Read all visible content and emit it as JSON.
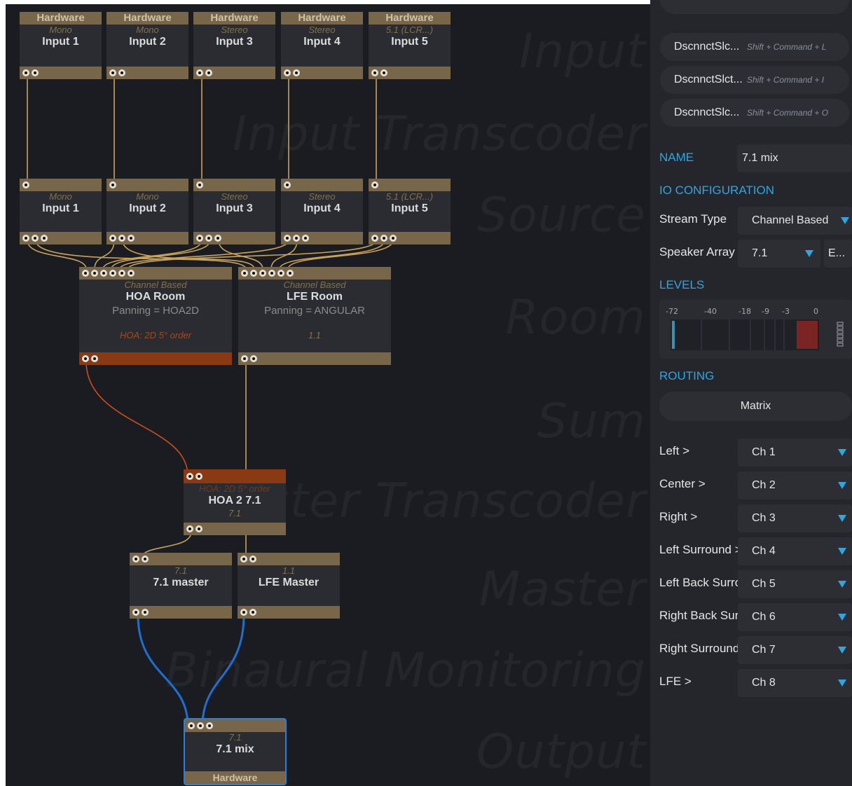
{
  "canvas": {
    "background_labels": [
      "Input",
      "Input Transcoder",
      "Source",
      "Room",
      "Sum",
      "Master Transcoder",
      "Master",
      "Binaural Monitoring",
      "Output"
    ],
    "wire_colors": {
      "default": "#c9a25c",
      "hoa": "#c8501a",
      "output": "#1f6fd0"
    }
  },
  "nodes": {
    "hw": [
      {
        "bar": "Hardware",
        "sub": "Mono",
        "title": "Input 1"
      },
      {
        "bar": "Hardware",
        "sub": "Mono",
        "title": "Input 2"
      },
      {
        "bar": "Hardware",
        "sub": "Stereo",
        "title": "Input 3"
      },
      {
        "bar": "Hardware",
        "sub": "Stereo",
        "title": "Input 4"
      },
      {
        "bar": "Hardware",
        "sub": "5.1 (LCR...)",
        "title": "Input 5"
      }
    ],
    "src": [
      {
        "sub": "Mono",
        "title": "Input 1"
      },
      {
        "sub": "Mono",
        "title": "Input 2"
      },
      {
        "sub": "Stereo",
        "title": "Input 3"
      },
      {
        "sub": "Stereo",
        "title": "Input 4"
      },
      {
        "sub": "5.1 (LCR...)",
        "title": "Input 5"
      }
    ],
    "hoa_room": {
      "sub": "Channel Based",
      "title": "HOA Room",
      "panning": "Panning = HOA2D",
      "footer": "HOA: 2D 5° order"
    },
    "lfe_room": {
      "sub": "Channel Based",
      "title": "LFE Room",
      "panning": "Panning = ANGULAR",
      "footer": "1.1"
    },
    "hoa2": {
      "header": "HOA: 2D 5° order",
      "title": "HOA 2 7.1",
      "sub": "7.1"
    },
    "master71": {
      "sub": "7.1",
      "title": "7.1 master"
    },
    "lfe_master": {
      "sub": "1.1",
      "title": "LFE Master"
    },
    "output": {
      "sub": "7.1",
      "title": "7.1 mix",
      "footer": "Hardware"
    }
  },
  "panel": {
    "disconnect_buttons": [
      {
        "label": "DscnnctSlc...",
        "shortcut": "Shift + Command + L"
      },
      {
        "label": "DscnnctSlct...",
        "shortcut": "Shift + Command + I"
      },
      {
        "label": "DscnnctSlc...",
        "shortcut": "Shift + Command + O"
      }
    ],
    "name_label": "NAME",
    "name_value": "7.1 mix",
    "io_config_label": "IO CONFIGURATION",
    "stream_type_label": "Stream Type",
    "stream_type_value": "Channel Based",
    "speaker_array_label": "Speaker Array",
    "speaker_array_value": "7.1",
    "edit_button": "E...",
    "levels_label": "LEVELS",
    "level_scale": [
      "-72",
      "-40",
      "-18",
      "-9",
      "-3",
      "0"
    ],
    "routing_label": "ROUTING",
    "matrix_button": "Matrix",
    "routing": [
      {
        "label": "Left >",
        "channel": "Ch 1"
      },
      {
        "label": "Center >",
        "channel": "Ch 2"
      },
      {
        "label": "Right >",
        "channel": "Ch 3"
      },
      {
        "label": "Left Surround >",
        "channel": "Ch 4"
      },
      {
        "label": "Left Back Surround >",
        "channel": "Ch 5"
      },
      {
        "label": "Right Back Surround >",
        "channel": "Ch 6"
      },
      {
        "label": "Right Surround >",
        "channel": "Ch 7"
      },
      {
        "label": "LFE >",
        "channel": "Ch 8"
      }
    ]
  }
}
